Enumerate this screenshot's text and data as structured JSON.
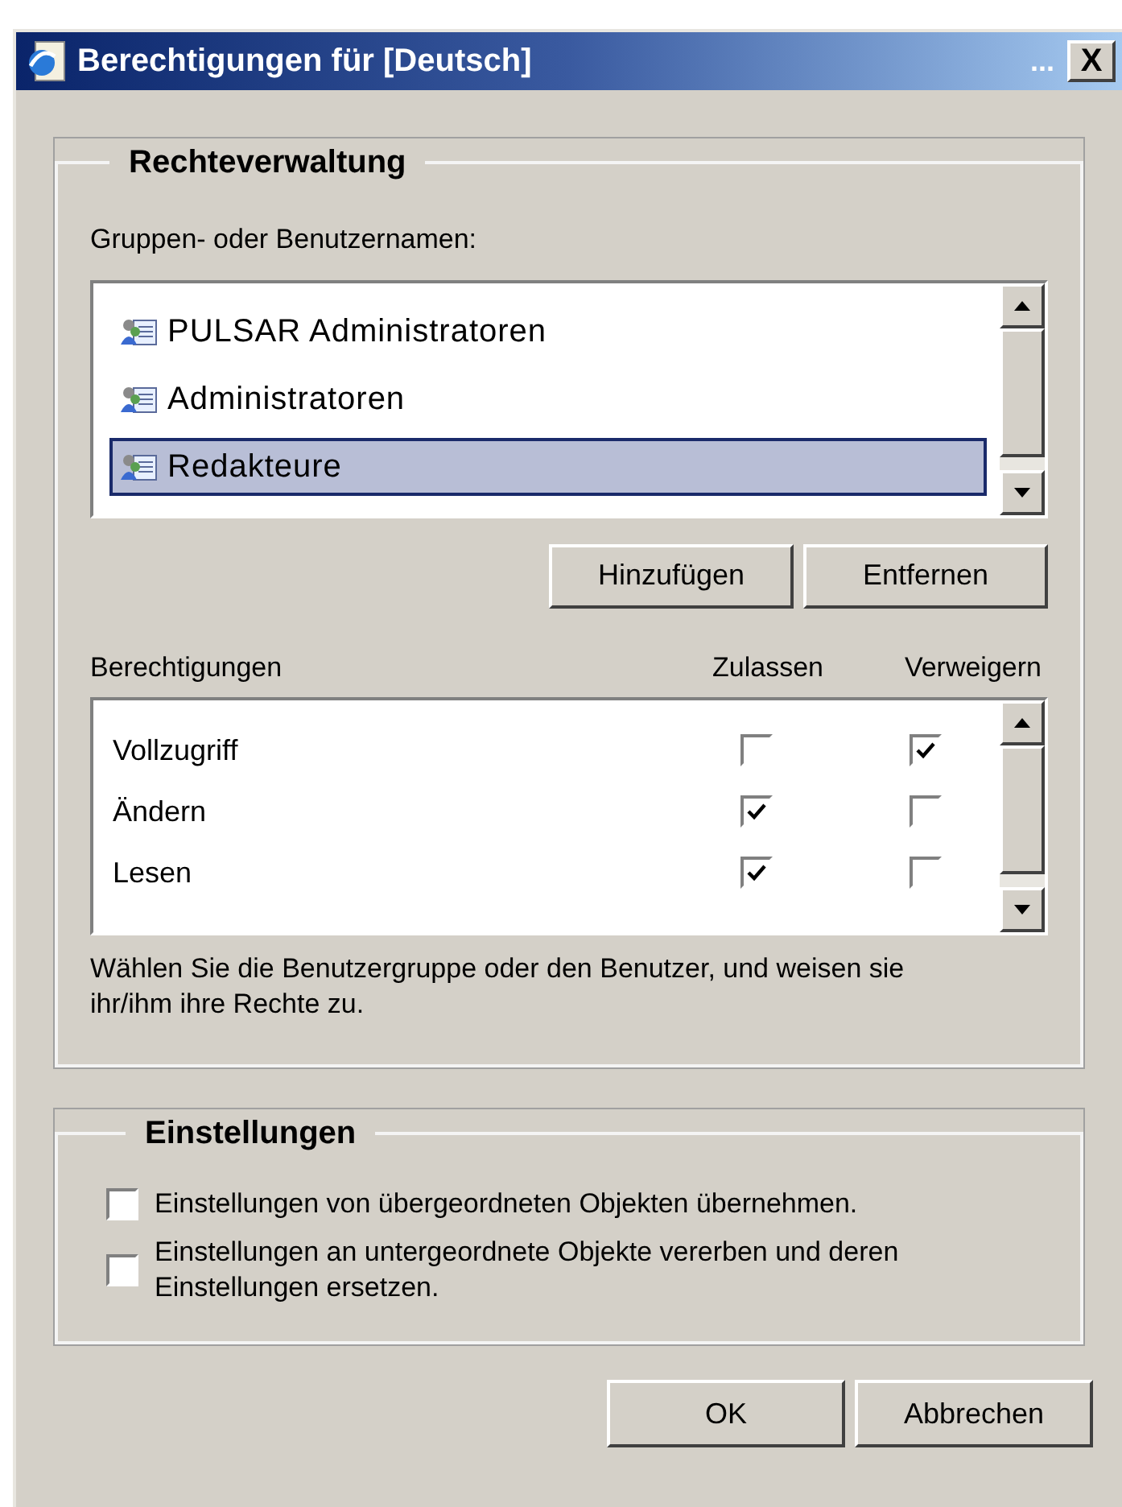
{
  "window": {
    "title": "Berechtigungen für [Deutsch]",
    "title_extra": "...",
    "close": "X"
  },
  "rights": {
    "legend": "Rechteverwaltung",
    "groups_label": "Gruppen- oder Benutzernamen:",
    "groups": [
      {
        "name": "PULSAR Administratoren",
        "selected": false
      },
      {
        "name": "Administratoren",
        "selected": false
      },
      {
        "name": "Redakteure",
        "selected": true
      }
    ],
    "add_button": "Hinzufügen",
    "remove_button": "Entfernen",
    "columns": [
      "Berechtigungen",
      "Zulassen",
      "Verweigern"
    ],
    "permissions": [
      {
        "name": "Vollzugriff",
        "allow": false,
        "deny": true
      },
      {
        "name": "Ändern",
        "allow": true,
        "deny": false
      },
      {
        "name": "Lesen",
        "allow": true,
        "deny": false
      }
    ],
    "hint": "Wählen Sie die Benutzergruppe oder den Benutzer, und weisen sie ihr/ihm ihre Rechte zu."
  },
  "settings": {
    "legend": "Einstellungen",
    "options": [
      {
        "label": "Einstellungen von übergeordneten Objekten übernehmen.",
        "checked": false
      },
      {
        "label": "Einstellungen an untergeordnete Objekte vererben und deren Einstellungen ersetzen.",
        "checked": false
      }
    ]
  },
  "buttons": [
    "OK",
    "Abbrechen"
  ]
}
